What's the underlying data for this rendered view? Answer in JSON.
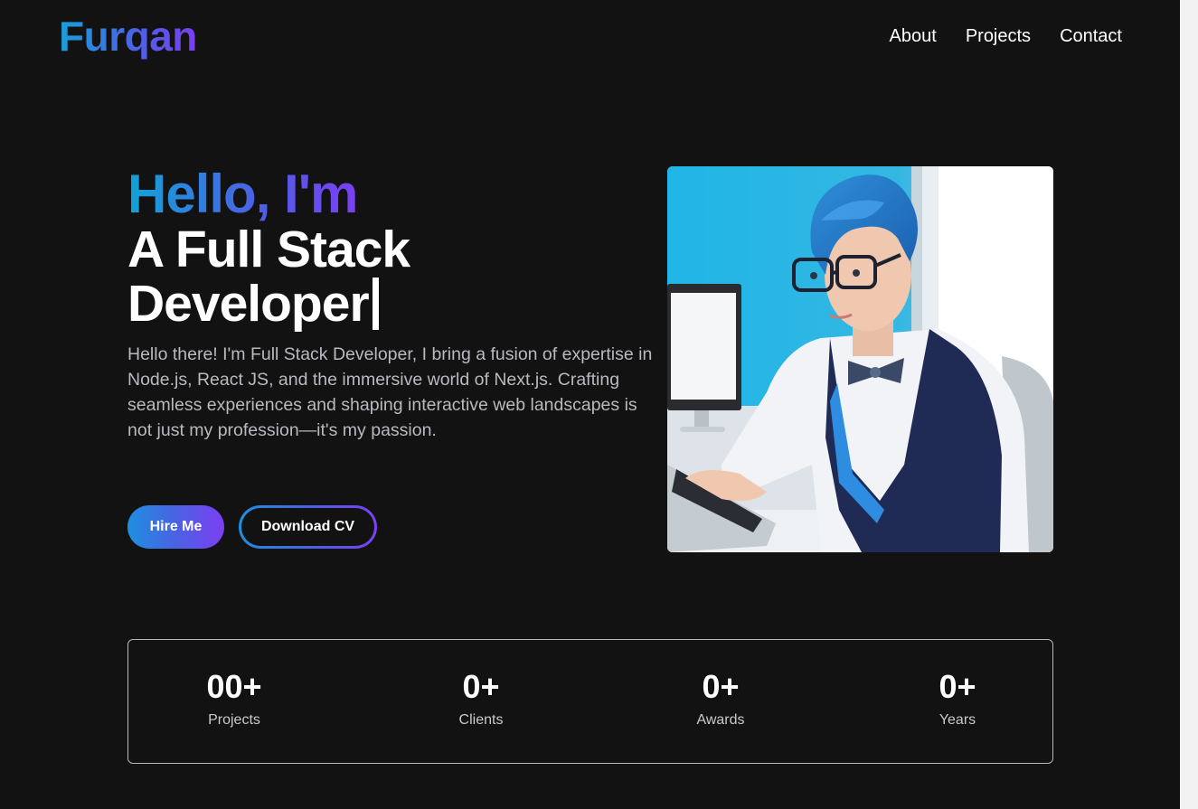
{
  "header": {
    "logo": "Furqan",
    "nav": [
      {
        "label": "About"
      },
      {
        "label": "Projects"
      },
      {
        "label": "Contact"
      }
    ]
  },
  "hero": {
    "greeting": "Hello, I'm",
    "role": "A Full Stack Developer",
    "bio": "Hello there! I'm Full Stack Developer, I bring a fusion of expertise in Node.js, React JS, and the immersive world of Next.js. Crafting seamless experiences and shaping interactive web landscapes is not just my profession—it's my passion.",
    "hire_label": "Hire Me",
    "cv_label": "Download CV"
  },
  "stats": [
    {
      "value": "00+",
      "label": "Projects"
    },
    {
      "value": "0+",
      "label": "Clients"
    },
    {
      "value": "0+",
      "label": "Awards"
    },
    {
      "value": "0+",
      "label": "Years"
    }
  ],
  "colors": {
    "background": "#121212",
    "gradient_start": "#12a3d6",
    "gradient_mid": "#4a62e4",
    "gradient_end": "#7b3ff2"
  }
}
